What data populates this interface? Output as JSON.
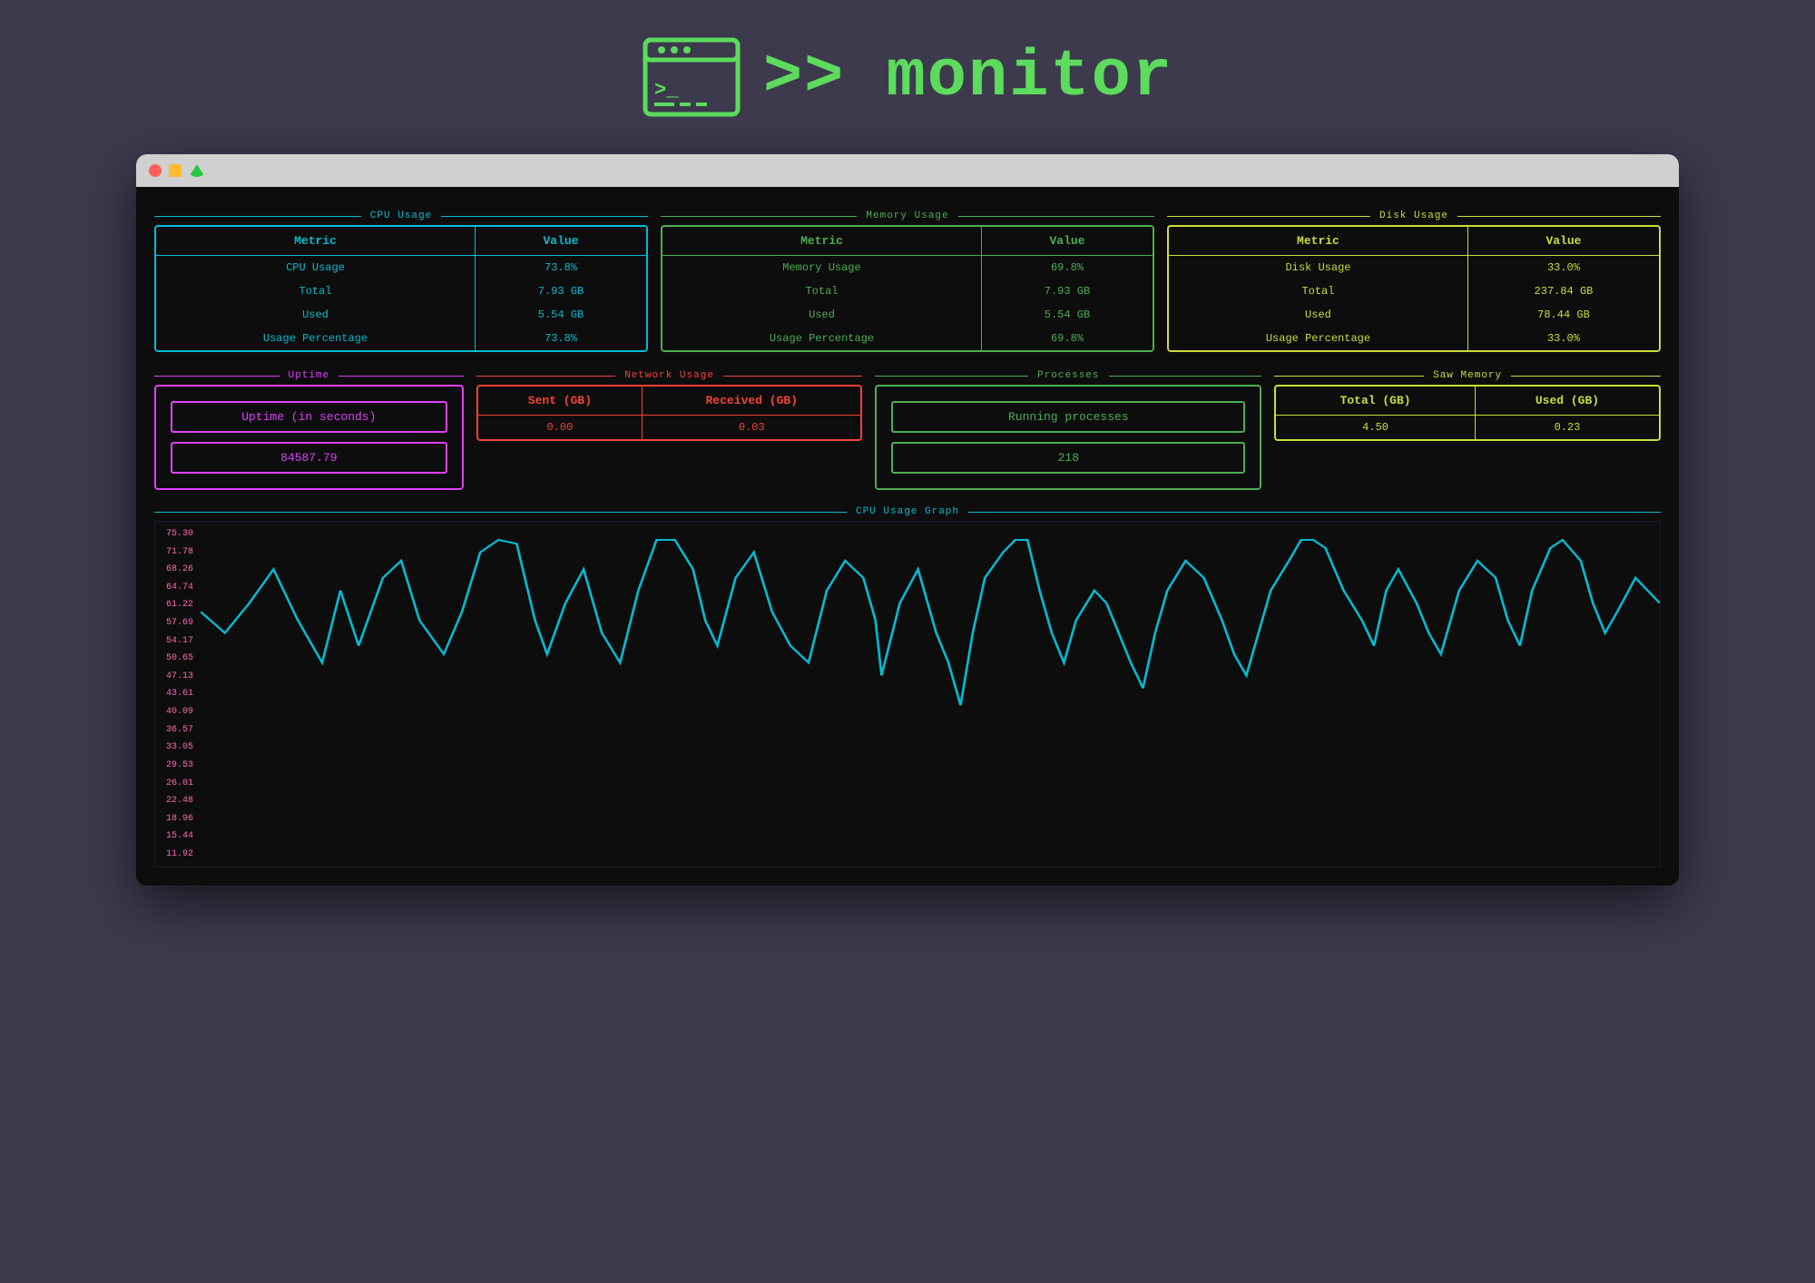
{
  "header": {
    "title": ">> monitor",
    "icon_label": "terminal-icon"
  },
  "cpu": {
    "panel_label": "CPU Usage",
    "col1": "Metric",
    "col2": "Value",
    "rows": [
      {
        "metric": "CPU Usage",
        "value": "73.8%"
      },
      {
        "metric": "Total",
        "value": "7.93 GB"
      },
      {
        "metric": "Used",
        "value": "5.54 GB"
      },
      {
        "metric": "Usage Percentage",
        "value": "73.8%"
      }
    ]
  },
  "memory": {
    "panel_label": "Memory Usage",
    "col1": "Metric",
    "col2": "Value",
    "rows": [
      {
        "metric": "Memory Usage",
        "value": "69.8%"
      },
      {
        "metric": "Total",
        "value": "7.93 GB"
      },
      {
        "metric": "Used",
        "value": "5.54 GB"
      },
      {
        "metric": "Usage Percentage",
        "value": "69.8%"
      }
    ]
  },
  "disk": {
    "panel_label": "Disk Usage",
    "col1": "Metric",
    "col2": "Value",
    "rows": [
      {
        "metric": "Disk Usage",
        "value": "33.0%"
      },
      {
        "metric": "Total",
        "value": "237.84 GB"
      },
      {
        "metric": "Used",
        "value": "78.44 GB"
      },
      {
        "metric": "Usage Percentage",
        "value": "33.0%"
      }
    ]
  },
  "uptime": {
    "panel_label": "Uptime",
    "label": "Uptime (in seconds)",
    "value": "84587.79"
  },
  "network": {
    "panel_label": "Network Usage",
    "col1": "Sent (GB)",
    "col2": "Received (GB)",
    "sent": "0.00",
    "received": "0.03"
  },
  "processes": {
    "panel_label": "Processes",
    "label": "Running processes",
    "value": "218"
  },
  "swap": {
    "panel_label": "Saw Memory",
    "col1": "Total (GB)",
    "col2": "Used (GB)",
    "total": "4.50",
    "used": "0.23"
  },
  "graph": {
    "panel_label": "CPU Usage Graph",
    "y_labels": [
      "75.30",
      "71.78",
      "68.26",
      "64.74",
      "61.22",
      "57.69",
      "54.17",
      "50.65",
      "47.13",
      "43.61",
      "40.09",
      "36.57",
      "33.05",
      "29.53",
      "26.01",
      "22.48",
      "18.96",
      "15.44",
      "11.92"
    ]
  },
  "titlebar": {
    "btn1": "close",
    "btn2": "minimize",
    "btn3": "maximize"
  }
}
